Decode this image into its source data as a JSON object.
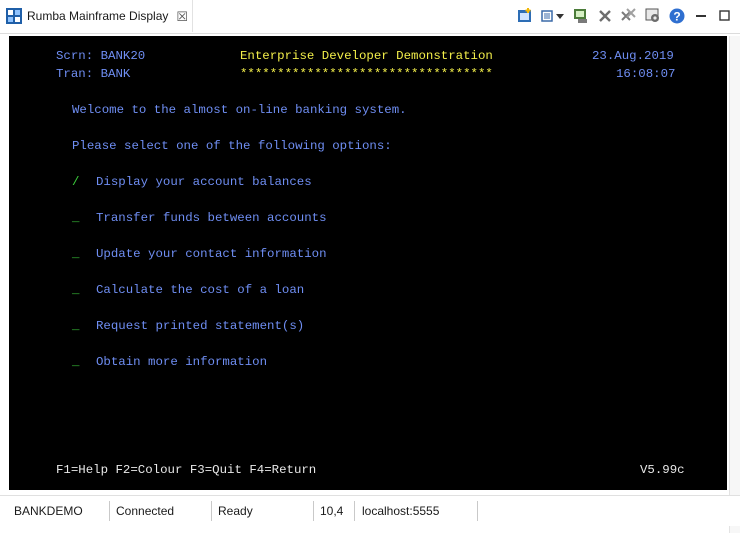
{
  "tab": {
    "title": "Rumba Mainframe Display",
    "close_glyph": "☒"
  },
  "toolbar": {
    "icons": [
      "add-session-icon",
      "menu-dropdown-icon",
      "disconnect-icon",
      "close-session-icon",
      "settings-icon",
      "keyboard-map-icon",
      "help-icon",
      "minimize-icon",
      "maximize-icon"
    ],
    "help_glyph": "?",
    "minimize_glyph": "—",
    "maximize_glyph": "☐"
  },
  "screen": {
    "scrn_label": "Scrn: BANK20",
    "tran_label": "Tran: BANK",
    "header_title": "Enterprise Developer Demonstration",
    "header_stars": "**********************************",
    "date": "23.Aug.2019",
    "time": "16:08:07",
    "welcome": "Welcome to the almost on-line banking system.",
    "prompt": "Please select one of the following options:",
    "options": [
      {
        "marker": "/",
        "label": "Display your account balances"
      },
      {
        "marker": "_",
        "label": "Transfer funds between accounts"
      },
      {
        "marker": "_",
        "label": "Update your contact information"
      },
      {
        "marker": "_",
        "label": "Calculate the cost of a loan"
      },
      {
        "marker": "_",
        "label": "Request printed statement(s)"
      },
      {
        "marker": "_",
        "label": "Obtain more information"
      }
    ],
    "function_keys": "F1=Help F2=Colour F3=Quit F4=Return",
    "version": "V5.99c"
  },
  "status": {
    "session": "BANKDEMO",
    "connection": "Connected",
    "state": "Ready",
    "cursor": "10,4",
    "host": "localhost:5555"
  },
  "colors": {
    "terminal_bg": "#000000",
    "field_blue": "#6f8ef3",
    "title_yellow": "#f3ef4a",
    "input_green": "#3ccf3c",
    "text_white": "#e8e8e8"
  }
}
